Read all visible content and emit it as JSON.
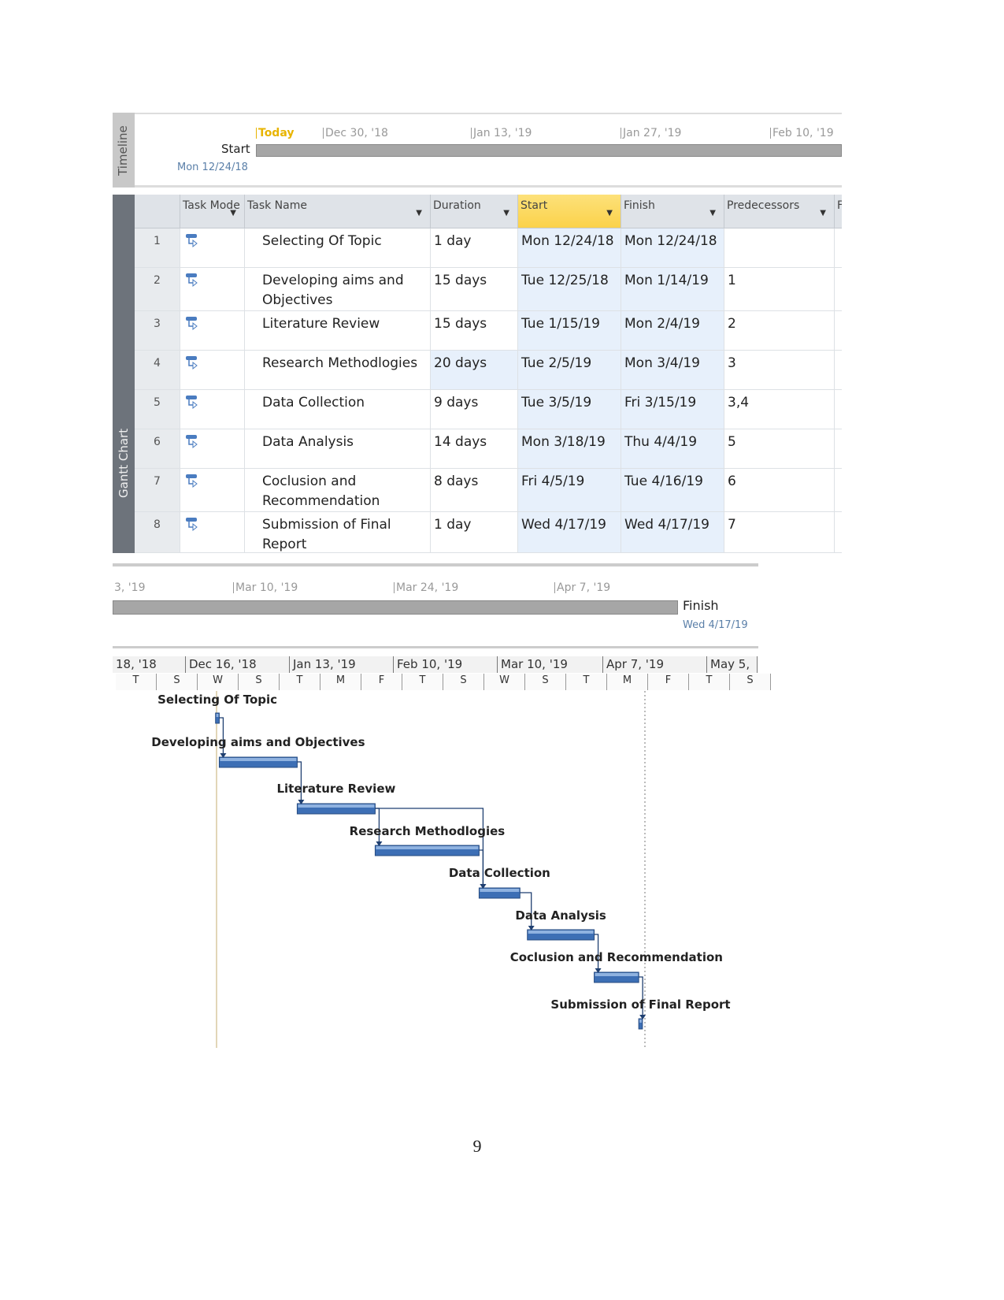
{
  "timeline": {
    "side_label": "Timeline",
    "start_label": "Start",
    "start_date": "Mon 12/24/18",
    "today_label": "Today",
    "ticks_top": [
      "Dec 30, '18",
      "Jan 13, '19",
      "Jan 27, '19",
      "Feb 10, '19"
    ],
    "ticks_bottom": [
      "3, '19",
      "Mar 10, '19",
      "Mar 24, '19",
      "Apr 7, '19"
    ],
    "finish_label": "Finish",
    "finish_date": "Wed 4/17/19",
    "today_color": "#e8b400"
  },
  "gantt": {
    "side_label": "Gantt Chart",
    "columns": {
      "mode": "Task Mode",
      "name": "Task Name",
      "duration": "Duration",
      "start": "Start",
      "finish": "Finish",
      "predecessors": "Predecessors",
      "extra": "F"
    },
    "tasks": [
      {
        "id": "1",
        "name": "Selecting Of Topic",
        "duration": "1 day",
        "start": "Mon 12/24/18",
        "finish": "Mon 12/24/18",
        "pred": "",
        "s": "2018-12-24",
        "f": "2018-12-24"
      },
      {
        "id": "2",
        "name": "Developing aims and Objectives",
        "duration": "15 days",
        "start": "Tue 12/25/18",
        "finish": "Mon 1/14/19",
        "pred": "1",
        "s": "2018-12-25",
        "f": "2019-01-14"
      },
      {
        "id": "3",
        "name": "Literature Review",
        "duration": "15 days",
        "start": "Tue 1/15/19",
        "finish": "Mon 2/4/19",
        "pred": "2",
        "s": "2019-01-15",
        "f": "2019-02-04"
      },
      {
        "id": "4",
        "name": "Research Methodlogies",
        "duration": "20 days",
        "start": "Tue 2/5/19",
        "finish": "Mon 3/4/19",
        "pred": "3",
        "s": "2019-02-05",
        "f": "2019-03-04"
      },
      {
        "id": "5",
        "name": "Data Collection",
        "duration": "9 days",
        "start": "Tue 3/5/19",
        "finish": "Fri 3/15/19",
        "pred": "3,4",
        "s": "2019-03-05",
        "f": "2019-03-15"
      },
      {
        "id": "6",
        "name": "Data Analysis",
        "duration": "14 days",
        "start": "Mon 3/18/19",
        "finish": "Thu 4/4/19",
        "pred": "5",
        "s": "2019-03-18",
        "f": "2019-04-04"
      },
      {
        "id": "7",
        "name": "Coclusion and Recommendation",
        "duration": "8 days",
        "start": "Fri 4/5/19",
        "finish": "Tue 4/16/19",
        "pred": "6",
        "s": "2019-04-05",
        "f": "2019-04-16"
      },
      {
        "id": "8",
        "name": "Submission of Final Report",
        "duration": "1 day",
        "start": "Wed 4/17/19",
        "finish": "Wed 4/17/19",
        "pred": "7",
        "s": "2019-04-17",
        "f": "2019-04-17"
      }
    ],
    "scale_top": [
      "18, '18",
      "Dec 16, '18",
      "Jan 13, '19",
      "Feb 10, '19",
      "Mar 10, '19",
      "Apr 7, '19",
      "May 5,"
    ],
    "scale_days": [
      "T",
      "S",
      "W",
      "S",
      "T",
      "M",
      "F",
      "T",
      "S",
      "W",
      "S",
      "T",
      "M",
      "F",
      "T",
      "S"
    ],
    "bar_color": "#3d6fb5"
  },
  "footer": {
    "page_number": "9"
  }
}
